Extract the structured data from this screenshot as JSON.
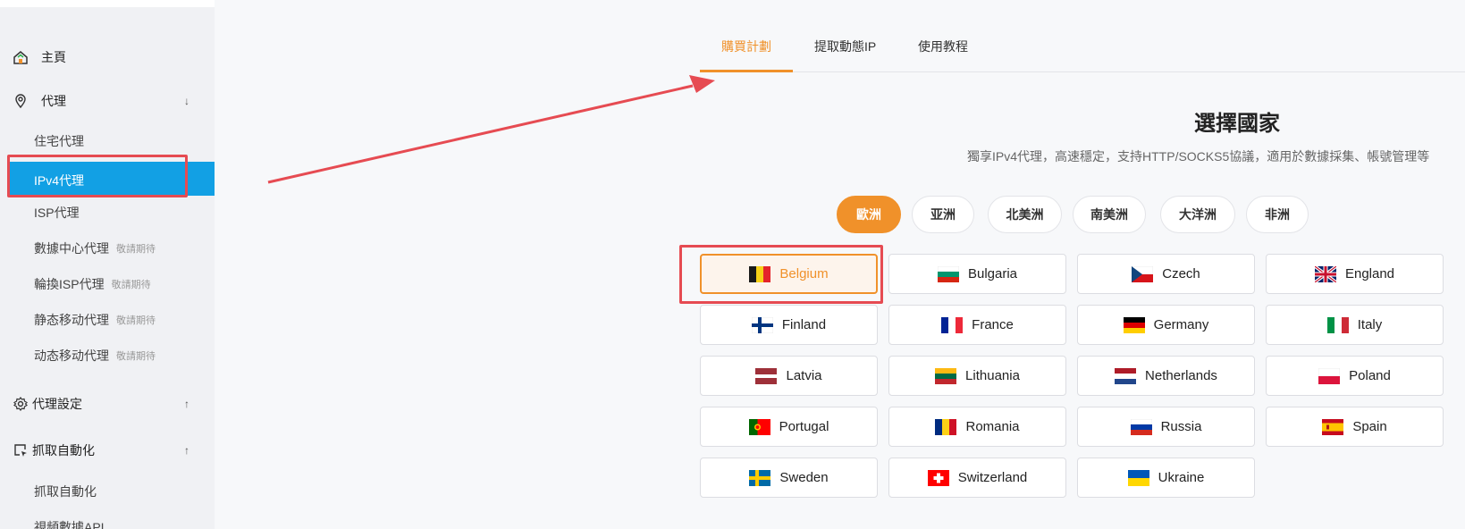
{
  "sidebar": {
    "home": "主頁",
    "proxy": "代理",
    "proxy_items": [
      {
        "label": "住宅代理",
        "tag": ""
      },
      {
        "label": "IPv4代理",
        "tag": ""
      },
      {
        "label": "ISP代理",
        "tag": ""
      },
      {
        "label": "數據中心代理",
        "tag": "敬請期待"
      },
      {
        "label": "輪換ISP代理",
        "tag": "敬請期待"
      },
      {
        "label": "静态移动代理",
        "tag": "敬請期待"
      },
      {
        "label": "动态移动代理",
        "tag": "敬請期待"
      }
    ],
    "proxy_settings": "代理設定",
    "scraping": "抓取自動化",
    "scraping_items": [
      "抓取自動化",
      "視頻數據API"
    ]
  },
  "tabs": [
    "購買計劃",
    "提取動態IP",
    "使用教程"
  ],
  "main": {
    "title": "選擇國家",
    "subtitle": "獨享IPv4代理，高速穩定，支持HTTP/SOCKS5協議，適用於數據採集、帳號管理等"
  },
  "regions": [
    "歐洲",
    "亚洲",
    "北美洲",
    "南美洲",
    "大洋洲",
    "非洲"
  ],
  "countries": [
    "Belgium",
    "Bulgaria",
    "Czech",
    "England",
    "Finland",
    "France",
    "Germany",
    "Italy",
    "Latvia",
    "Lithuania",
    "Netherlands",
    "Poland",
    "Portugal",
    "Romania",
    "Russia",
    "Spain",
    "Sweden",
    "Switzerland",
    "Ukraine"
  ],
  "colors": {
    "accent": "#f0912a",
    "active_nav": "#12a0e4",
    "annotation": "#e64b52"
  }
}
